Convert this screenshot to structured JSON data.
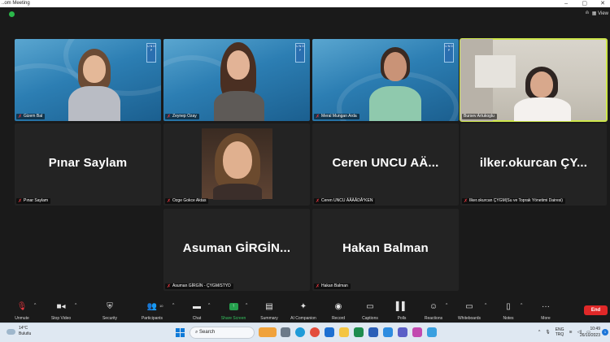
{
  "window": {
    "title": "..om Meeting",
    "minimize": "–",
    "restore": "▢",
    "close": "✕"
  },
  "top": {
    "view_label": "View"
  },
  "tiles": [
    {
      "name": "Gizem Bal",
      "muted": true,
      "video": true
    },
    {
      "name": "Zeynep Ozay",
      "muted": true,
      "video": true
    },
    {
      "name": "Meral Mungan Arda",
      "muted": true,
      "video": true
    },
    {
      "name": "Bursev Artukoglu",
      "muted": false,
      "video": true,
      "active": true
    },
    {
      "name": "Pınar Saylam",
      "display_name": "Pınar Saylam",
      "muted": true,
      "video": false
    },
    {
      "name": "Ozge Gokce Aktas",
      "muted": true,
      "video": true
    },
    {
      "name": "Ceren UNCU ÄÅÄÂDÂ°KEN",
      "display_name": "Ceren  UNCU  AÄ...",
      "muted": true,
      "video": false
    },
    {
      "name": "Ilker.okurcan ÇYGM(Su ve Toprak Yönetimi Dairesi)",
      "display_name": "ilker.okurcan  ÇY...",
      "muted": true,
      "video": false
    },
    {
      "name": "Asuman GİRGİN - ÇYGM/STYD",
      "display_name": "Asuman  GİRGİN...",
      "muted": true,
      "video": false
    },
    {
      "name": "Hakan Balman",
      "display_name": "Hakan Balman",
      "muted": true,
      "video": false
    }
  ],
  "logo_text": "U N D P",
  "toolbar": {
    "unmute": "Unmute",
    "stop_video": "Stop Video",
    "security": "Security",
    "participants": "Participants",
    "participants_count": "10",
    "chat": "Chat",
    "share_screen": "Share Screen",
    "summary": "Summary",
    "ai_companion": "AI Companion",
    "record": "Record",
    "captions": "Captions",
    "polls": "Polls",
    "reactions": "Reactions",
    "whiteboards": "Whiteboards",
    "notes": "Notes",
    "more": "More",
    "end": "End"
  },
  "taskbar": {
    "temp": "14°C",
    "condition": "Bulutlu",
    "search_placeholder": "Search",
    "lang_top": "ENG",
    "lang_bottom": "TRQ",
    "time": "10:49",
    "date": "26/10/2023",
    "notification_count": "1"
  },
  "colors": {
    "active_speaker": "#cde64b",
    "share_green": "#25a04d",
    "end_red": "#e02828",
    "muted_red": "#e8373f"
  }
}
